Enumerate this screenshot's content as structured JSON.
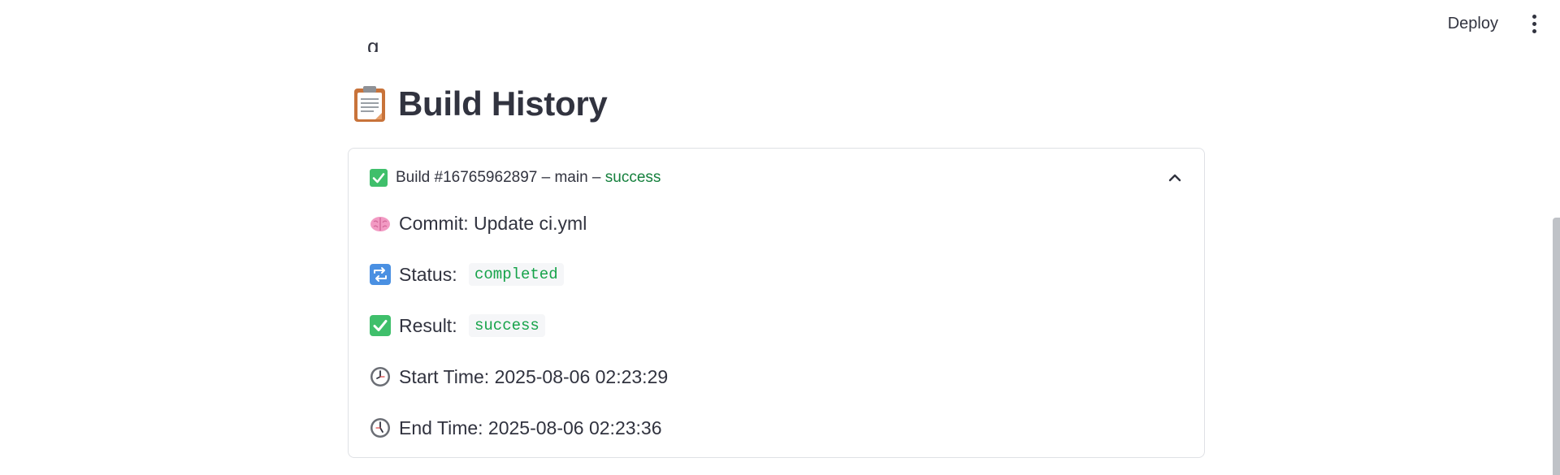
{
  "toolbar": {
    "deploy_label": "Deploy",
    "more_icon": "vertical-dots-icon"
  },
  "clipped_previous_text": "g",
  "section": {
    "icon": "clipboard-icon",
    "title": "Build History"
  },
  "build": {
    "icon": "check-box-icon",
    "title_prefix": "Build #16765962897 – main – ",
    "status_word": "success",
    "expanded": true,
    "details": [
      {
        "icon": "brain-icon",
        "label": "Commit: Update ci.yml",
        "code": null
      },
      {
        "icon": "repeat-icon",
        "label": "Status: ",
        "code": "completed"
      },
      {
        "icon": "check-box-icon",
        "label": "Result: ",
        "code": "success"
      },
      {
        "icon": "clock-icon",
        "label": "Start Time: 2025-08-06 02:23:29",
        "code": null
      },
      {
        "icon": "clock-icon",
        "label": "End Time: 2025-08-06 02:23:36",
        "code": null
      }
    ]
  },
  "colors": {
    "text": "#31333f",
    "success": "#15803d",
    "code_bg": "#f5f6f8",
    "border": "#dfe1e5"
  }
}
